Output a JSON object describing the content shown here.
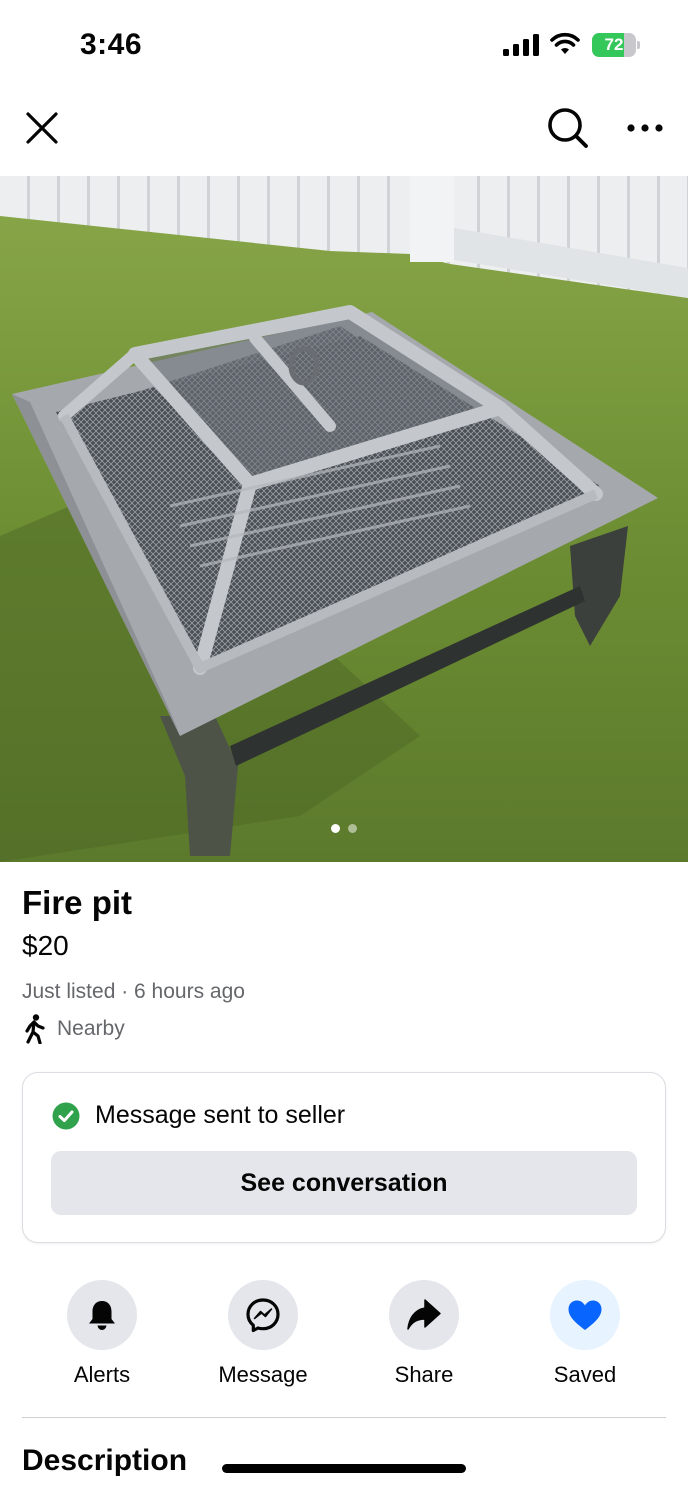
{
  "status_bar": {
    "time": "3:46",
    "battery_percent": "72",
    "battery_level": 0.72,
    "battery_color": "#34c759"
  },
  "nav": {
    "close_icon": "close-icon",
    "search_icon": "search-icon",
    "more_icon": "more-horizontal-icon"
  },
  "photo": {
    "page_count": 2,
    "current_page": 1
  },
  "listing": {
    "title": "Fire pit",
    "price": "$20",
    "listed": "Just listed · 6 hours ago",
    "location": "Nearby"
  },
  "message_card": {
    "status": "Message sent to seller",
    "button_label": "See conversation",
    "status_color": "#31a24c"
  },
  "actions": [
    {
      "label": "Alerts",
      "icon": "bell-icon"
    },
    {
      "label": "Message",
      "icon": "messenger-icon"
    },
    {
      "label": "Share",
      "icon": "share-arrow-icon"
    },
    {
      "label": "Saved",
      "icon": "heart-icon",
      "color": "#0866ff"
    }
  ],
  "description": {
    "heading": "Description"
  }
}
